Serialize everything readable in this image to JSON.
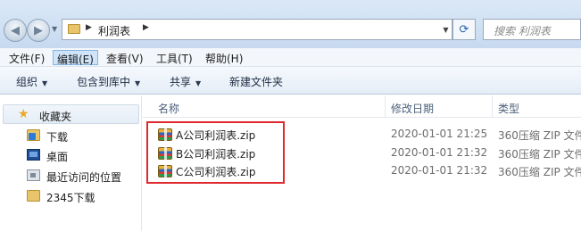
{
  "address_bar": {
    "path": [
      "利润表"
    ],
    "search_placeholder": "搜索 利润表"
  },
  "menu": {
    "items": [
      "文件(F)",
      "编辑(E)",
      "查看(V)",
      "工具(T)",
      "帮助(H)"
    ],
    "active": "编辑(E)"
  },
  "toolbar": {
    "organize": "组织",
    "include_in_library": "包含到库中",
    "share": "共享",
    "new_folder": "新建文件夹"
  },
  "nav": {
    "favorites": "收藏夹",
    "items": [
      "下载",
      "桌面",
      "最近访问的位置",
      "2345下载"
    ]
  },
  "columns": {
    "name": "名称",
    "date_modified": "修改日期",
    "type": "类型"
  },
  "files": [
    {
      "name": "A公司利润表.zip",
      "date": "2020-01-01 21:25",
      "type": "360压缩 ZIP 文件"
    },
    {
      "name": "B公司利润表.zip",
      "date": "2020-01-01 21:32",
      "type": "360压缩 ZIP 文件"
    },
    {
      "name": "C公司利润表.zip",
      "date": "2020-01-01 21:32",
      "type": "360压缩 ZIP 文件"
    }
  ],
  "colors": {
    "highlight_border": "#e0282d",
    "menu_active": "#cfe3f9"
  }
}
